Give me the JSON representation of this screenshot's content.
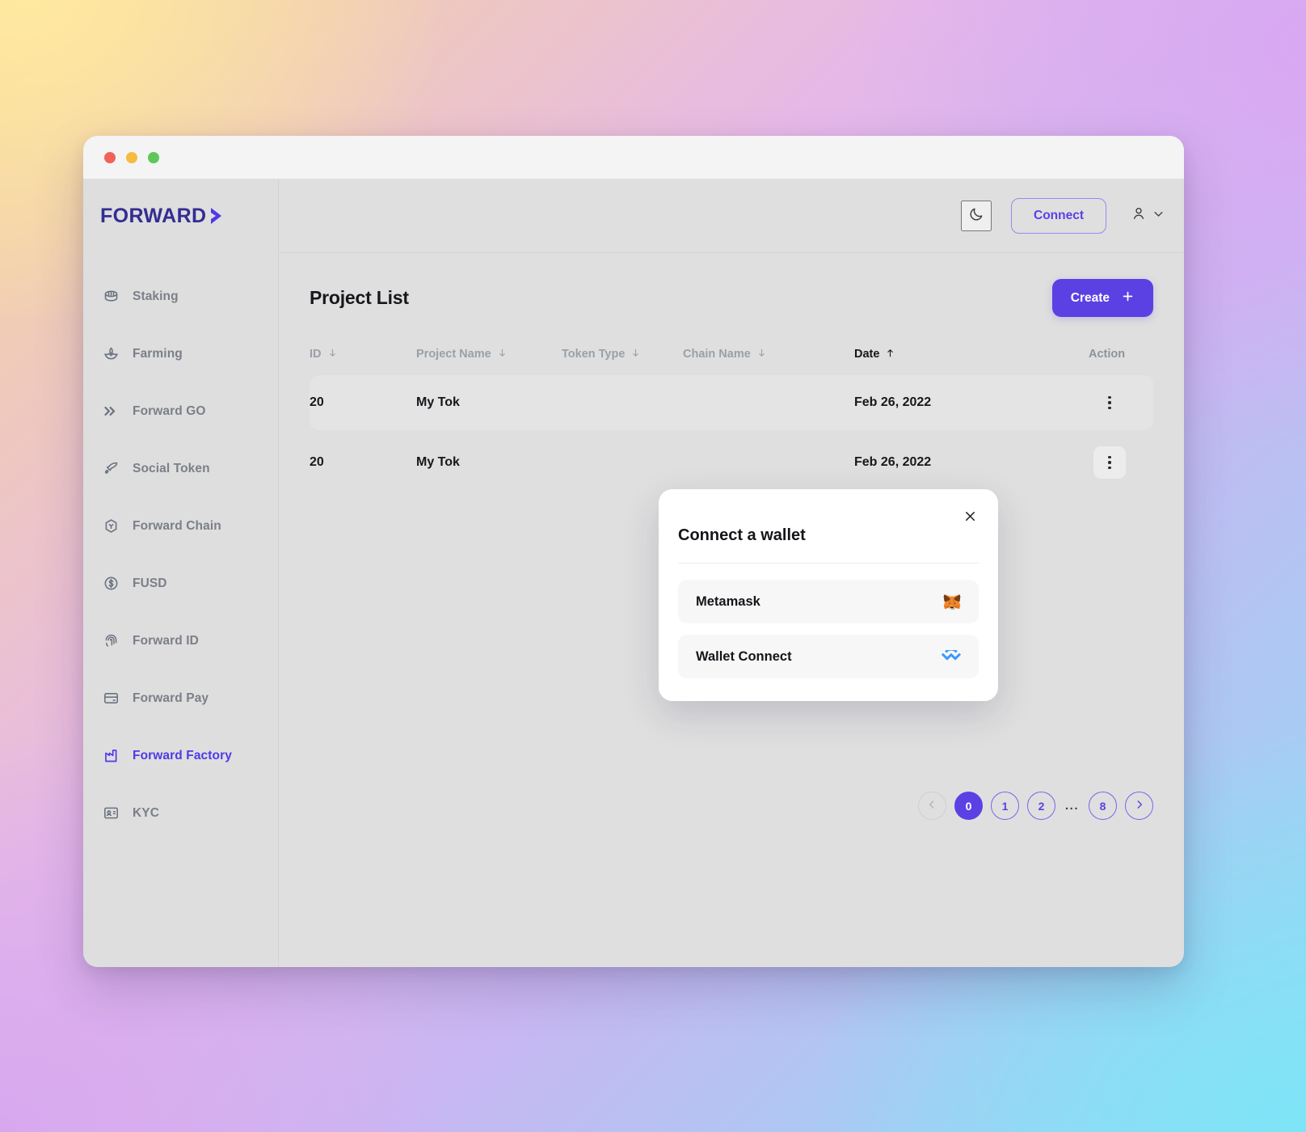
{
  "window": {
    "traffic_lights": [
      "close",
      "minimize",
      "maximize"
    ]
  },
  "brand": {
    "logo_text": "FORWARD",
    "logo_icon": "chevron-right-icon",
    "logo_color": "#332d92",
    "accent_color": "#5b41e3"
  },
  "sidebar": {
    "items": [
      {
        "label": "Staking",
        "icon": "coin-stack-icon",
        "active": false
      },
      {
        "label": "Farming",
        "icon": "sprout-icon",
        "active": false
      },
      {
        "label": "Forward GO",
        "icon": "double-chevron-icon",
        "active": false
      },
      {
        "label": "Social Token",
        "icon": "rocket-icon",
        "active": false
      },
      {
        "label": "Forward Chain",
        "icon": "hexagon-link-icon",
        "active": false
      },
      {
        "label": "FUSD",
        "icon": "dollar-coin-icon",
        "active": false
      },
      {
        "label": "Forward ID",
        "icon": "fingerprint-icon",
        "active": false
      },
      {
        "label": "Forward Pay",
        "icon": "credit-card-icon",
        "active": false
      },
      {
        "label": "Forward Factory",
        "icon": "factory-icon",
        "active": true
      },
      {
        "label": "KYC",
        "icon": "id-card-icon",
        "active": false
      }
    ]
  },
  "topbar": {
    "theme_toggle_icon": "moon-icon",
    "connect_label": "Connect",
    "account_icon": "user-icon",
    "account_chevron_icon": "chevron-down-icon"
  },
  "page": {
    "title": "Project List",
    "create_label": "Create",
    "create_icon": "plus-icon"
  },
  "table": {
    "columns": [
      {
        "label": "ID",
        "sort": "down",
        "active": false
      },
      {
        "label": "Project Name",
        "sort": "down",
        "active": false
      },
      {
        "label": "Token Type",
        "sort": "down",
        "active": false
      },
      {
        "label": "Chain Name",
        "sort": "down",
        "active": false
      },
      {
        "label": "Date",
        "sort": "up",
        "active": true
      },
      {
        "label": "Action",
        "sort": "",
        "active": false
      }
    ],
    "rows": [
      {
        "id": "20",
        "project_name": "My Tok",
        "token_type": "",
        "chain_name": "",
        "date": "Feb 26, 2022",
        "action_icon": "kebab-menu-icon",
        "row_hover": true,
        "action_pressed": false
      },
      {
        "id": "20",
        "project_name": "My Tok",
        "token_type": "",
        "chain_name": "",
        "date": "Feb 26, 2022",
        "action_icon": "kebab-menu-icon",
        "row_hover": false,
        "action_pressed": true
      }
    ]
  },
  "pagination": {
    "prev_icon": "chevron-left-icon",
    "next_icon": "chevron-right-icon",
    "pages": [
      "0",
      "1",
      "2"
    ],
    "ellipsis": "...",
    "last_page": "8",
    "current": "0",
    "prev_disabled": true
  },
  "modal": {
    "title": "Connect a wallet",
    "close_icon": "close-icon",
    "options": [
      {
        "label": "Metamask",
        "icon": "metamask-fox-icon"
      },
      {
        "label": "Wallet Connect",
        "icon": "walletconnect-icon"
      }
    ]
  }
}
